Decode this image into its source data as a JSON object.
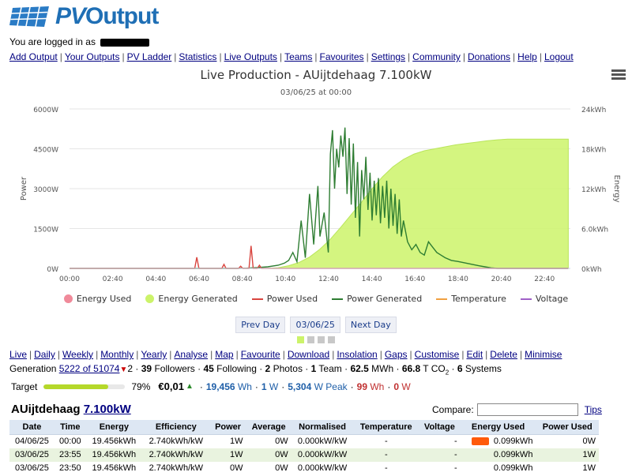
{
  "logo": {
    "text_pv": "PV",
    "text_output": "Output"
  },
  "user": {
    "logged_in_text": "You are logged in as"
  },
  "top_nav": [
    "Add Output",
    "Your Outputs",
    "PV Ladder",
    "Statistics",
    "Live Outputs",
    "Teams",
    "Favourites",
    "Settings",
    "Community",
    "Donations",
    "Help",
    "Logout"
  ],
  "chart": {
    "title": "Live Production - AUijtdehaag 7.100kW",
    "subtitle": "03/06/25 at 00:00",
    "legend": [
      {
        "label": "Energy Used",
        "color": "#f08a9a",
        "kind": "dot"
      },
      {
        "label": "Energy Generated",
        "color": "#ccf36a",
        "kind": "dot"
      },
      {
        "label": "Power Used",
        "color": "#d9453f",
        "kind": "line"
      },
      {
        "label": "Power Generated",
        "color": "#2e7d32",
        "kind": "line"
      },
      {
        "label": "Temperature",
        "color": "#f0a040",
        "kind": "line"
      },
      {
        "label": "Voltage",
        "color": "#a060c8",
        "kind": "line"
      }
    ],
    "prev_day": "Prev Day",
    "date": "03/06/25",
    "next_day": "Next Day"
  },
  "chart_data": {
    "type": "line",
    "title": "Live Production - AUijtdehaag 7.100kW",
    "subtitle": "03/06/25 at 00:00",
    "x_ticks": [
      "00:00",
      "02:40",
      "04:40",
      "06:40",
      "08:40",
      "10:40",
      "12:40",
      "14:40",
      "16:40",
      "18:40",
      "20:40",
      "22:40"
    ],
    "y_left_ticks": [
      "0W",
      "1500W",
      "3000W",
      "4500W",
      "6000W"
    ],
    "y_right_ticks": [
      "0kWh",
      "6.0kWh",
      "12kWh",
      "18kWh",
      "24kWh"
    ],
    "ylabel_left": "Power",
    "ylabel_right": "Energy",
    "ylim_left": [
      0,
      6000
    ],
    "ylim_right": [
      0,
      24
    ],
    "x_range_hours": [
      0,
      24
    ],
    "series": [
      {
        "name": "Energy Generated",
        "axis": "right",
        "kind": "area",
        "color": "#ccf36a",
        "points": [
          [
            0,
            0
          ],
          [
            9.5,
            0
          ],
          [
            10.0,
            0.1
          ],
          [
            10.5,
            0.4
          ],
          [
            11.0,
            0.9
          ],
          [
            11.5,
            1.7
          ],
          [
            12.0,
            2.9
          ],
          [
            12.5,
            4.4
          ],
          [
            13.0,
            6.2
          ],
          [
            13.5,
            8.1
          ],
          [
            14.0,
            10.0
          ],
          [
            14.5,
            12.0
          ],
          [
            15.0,
            13.8
          ],
          [
            15.5,
            15.3
          ],
          [
            16.0,
            16.4
          ],
          [
            16.5,
            17.2
          ],
          [
            17.0,
            17.7
          ],
          [
            17.5,
            18.0
          ],
          [
            18.0,
            18.3
          ],
          [
            18.5,
            18.6
          ],
          [
            19.0,
            18.8
          ],
          [
            19.5,
            19.0
          ],
          [
            20.0,
            19.2
          ],
          [
            20.5,
            19.35
          ],
          [
            21.0,
            19.45
          ],
          [
            23.9,
            19.456
          ]
        ]
      },
      {
        "name": "Power Generated",
        "axis": "left",
        "kind": "line",
        "color": "#2e7d32",
        "points": [
          [
            0,
            0
          ],
          [
            8.0,
            0
          ],
          [
            8.5,
            10
          ],
          [
            9.0,
            30
          ],
          [
            9.5,
            60
          ],
          [
            10.0,
            120
          ],
          [
            10.3,
            200
          ],
          [
            10.5,
            300
          ],
          [
            10.7,
            600
          ],
          [
            10.9,
            250
          ],
          [
            11.1,
            1800
          ],
          [
            11.3,
            400
          ],
          [
            11.5,
            2800
          ],
          [
            11.7,
            900
          ],
          [
            11.9,
            3100
          ],
          [
            12.0,
            1200
          ],
          [
            12.2,
            2100
          ],
          [
            12.4,
            600
          ],
          [
            12.5,
            4300
          ],
          [
            12.6,
            5200
          ],
          [
            12.7,
            3000
          ],
          [
            12.8,
            4500
          ],
          [
            12.9,
            3800
          ],
          [
            13.0,
            5000
          ],
          [
            13.1,
            4200
          ],
          [
            13.2,
            5300
          ],
          [
            13.3,
            2800
          ],
          [
            13.4,
            4900
          ],
          [
            13.5,
            2400
          ],
          [
            13.6,
            4700
          ],
          [
            13.7,
            1900
          ],
          [
            13.8,
            4000
          ],
          [
            13.9,
            1200
          ],
          [
            14.0,
            3700
          ],
          [
            14.1,
            2600
          ],
          [
            14.2,
            4200
          ],
          [
            14.3,
            2200
          ],
          [
            14.4,
            3600
          ],
          [
            14.5,
            1800
          ],
          [
            14.6,
            3300
          ],
          [
            14.7,
            2000
          ],
          [
            14.8,
            3400
          ],
          [
            14.9,
            1700
          ],
          [
            15.0,
            3100
          ],
          [
            15.1,
            1900
          ],
          [
            15.2,
            3300
          ],
          [
            15.3,
            1500
          ],
          [
            15.4,
            3000
          ],
          [
            15.5,
            1600
          ],
          [
            15.6,
            2800
          ],
          [
            15.7,
            1300
          ],
          [
            15.8,
            2600
          ],
          [
            15.9,
            1200
          ],
          [
            16.0,
            1800
          ],
          [
            16.2,
            1000
          ],
          [
            16.4,
            700
          ],
          [
            16.6,
            900
          ],
          [
            16.8,
            600
          ],
          [
            17.0,
            500
          ],
          [
            17.2,
            1000
          ],
          [
            17.4,
            800
          ],
          [
            17.6,
            600
          ],
          [
            17.8,
            500
          ],
          [
            18.0,
            400
          ],
          [
            18.3,
            300
          ],
          [
            18.6,
            260
          ],
          [
            19.0,
            200
          ],
          [
            19.3,
            150
          ],
          [
            19.6,
            100
          ],
          [
            19.9,
            60
          ],
          [
            20.2,
            20
          ],
          [
            20.5,
            0
          ],
          [
            23.9,
            0
          ]
        ]
      },
      {
        "name": "Power Used",
        "axis": "left",
        "kind": "line",
        "color": "#d9453f",
        "points": [
          [
            0,
            0
          ],
          [
            5.8,
            0
          ],
          [
            6.0,
            0
          ],
          [
            6.1,
            420
          ],
          [
            6.2,
            0
          ],
          [
            7.3,
            0
          ],
          [
            7.4,
            150
          ],
          [
            7.5,
            0
          ],
          [
            8.1,
            0
          ],
          [
            8.2,
            80
          ],
          [
            8.3,
            0
          ],
          [
            8.6,
            0
          ],
          [
            8.7,
            850
          ],
          [
            8.8,
            0
          ],
          [
            9.0,
            0
          ],
          [
            9.1,
            120
          ],
          [
            9.2,
            0
          ],
          [
            23.9,
            0
          ]
        ]
      },
      {
        "name": "Energy Used",
        "axis": "right",
        "kind": "area",
        "color": "#f08a9a",
        "points": [
          [
            0,
            0
          ],
          [
            23.9,
            0.099
          ]
        ]
      }
    ]
  },
  "sub_nav": [
    "Live",
    "Daily",
    "Weekly",
    "Monthly",
    "Yearly",
    "Analyse",
    "Map",
    "Favourite",
    "Download",
    "Insolation",
    "Gaps",
    "Customise",
    "Edit",
    "Delete",
    "Minimise"
  ],
  "stats": {
    "generation_label": "Generation",
    "rank_text": "5222 of 51074",
    "rank_change": "2",
    "followers_count": "39",
    "followers_label": "Followers",
    "following_count": "45",
    "following_label": "Following",
    "photos_count": "2",
    "photos_label": "Photos",
    "team_count": "1",
    "team_label": "Team",
    "mwh": "62.5",
    "mwh_unit": "MWh",
    "co2_value": "66.8",
    "co2_unit": "T CO",
    "co2_sub": "2",
    "systems_count": "6",
    "systems_label": "Systems"
  },
  "target": {
    "label": "Target",
    "percent": 79,
    "percent_text": "79%",
    "money": "€0,01",
    "energy": "19,456",
    "energy_unit": "Wh",
    "power": "1",
    "power_unit": "W",
    "peak": "5,304",
    "peak_unit": "W Peak",
    "used_energy": "99",
    "used_energy_unit": "Wh",
    "used_power": "0",
    "used_power_unit": "W"
  },
  "system": {
    "name": "AUijtdehaag",
    "size_link": "7.100kW",
    "compare_label": "Compare:",
    "compare_value": "",
    "tips": "Tips"
  },
  "table": {
    "headers": [
      "Date",
      "Time",
      "Energy",
      "Efficiency",
      "Power",
      "Average",
      "Normalised",
      "Temperature",
      "Voltage",
      "Energy Used",
      "Power Used"
    ],
    "rows": [
      [
        "04/06/25",
        "00:00",
        "19.456kWh",
        "2.740kWh/kW",
        "1W",
        "0W",
        "0.000kW/kW",
        "-",
        "-",
        "0.099kWh",
        "0W"
      ],
      [
        "03/06/25",
        "23:55",
        "19.456kWh",
        "2.740kWh/kW",
        "1W",
        "0W",
        "0.000kW/kW",
        "-",
        "-",
        "0.099kWh",
        "1W"
      ],
      [
        "03/06/25",
        "23:50",
        "19.456kWh",
        "2.740kWh/kW",
        "0W",
        "0W",
        "0.000kW/kW",
        "-",
        "-",
        "0.099kWh",
        "1W"
      ]
    ]
  }
}
